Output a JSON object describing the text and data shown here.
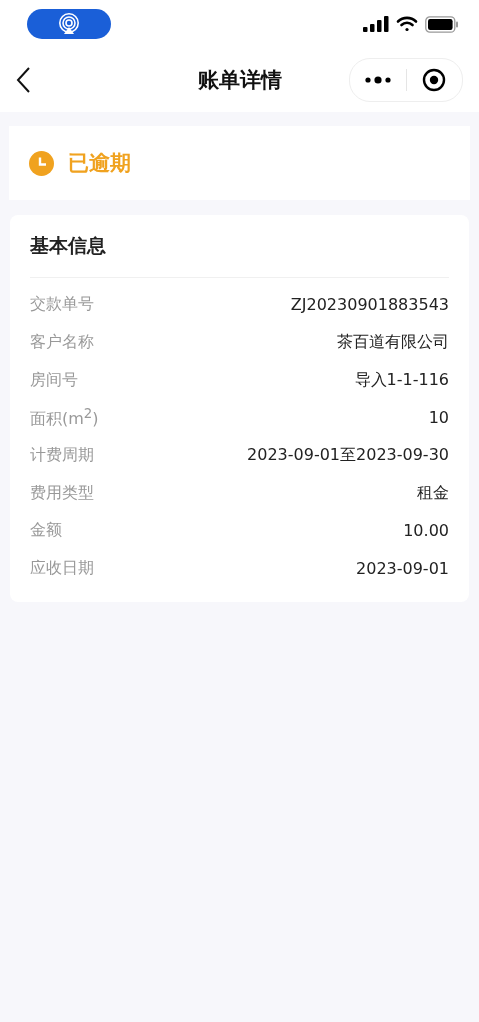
{
  "nav_bar": {
    "title": "账单详情"
  },
  "status": {
    "kind": "overdue",
    "label": "已逾期"
  },
  "info_card": {
    "title": "基本信息",
    "rows": [
      {
        "label": "交款单号",
        "value": "ZJ20230901883543"
      },
      {
        "label": "客户名称",
        "value": "茶百道有限公司"
      },
      {
        "label": "房间号",
        "value": "导入1-1-116"
      },
      {
        "label": "面积(m$^{2}$)",
        "value": "10"
      },
      {
        "label": "计费周期",
        "value": "2023-09-01至2023-09-30"
      },
      {
        "label": "费用类型",
        "value": "租金"
      },
      {
        "label": "金额",
        "value": "10.00"
      },
      {
        "label": "应收日期",
        "value": "2023-09-01"
      }
    ]
  }
}
